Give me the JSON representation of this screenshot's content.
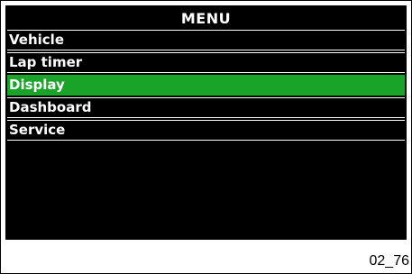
{
  "menu": {
    "title": "MENU",
    "items": [
      {
        "label": "Vehicle",
        "selected": false
      },
      {
        "label": "Lap timer",
        "selected": false
      },
      {
        "label": "Display",
        "selected": true
      },
      {
        "label": "Dashboard",
        "selected": false
      },
      {
        "label": "Service",
        "selected": false
      }
    ],
    "selected_color": "#1aa329",
    "background_color": "#000000",
    "text_color": "#ffffff"
  },
  "figure_id": "02_76"
}
